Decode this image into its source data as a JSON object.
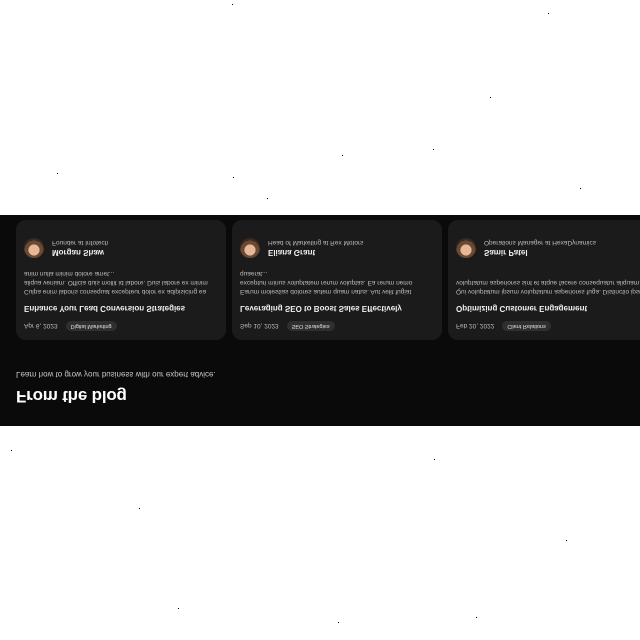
{
  "blog": {
    "title": "From the blog",
    "subtitle": "Learn how to grow your business with our expert advice."
  },
  "posts": [
    {
      "date": "Apr 6, 2023",
      "tag": "Digital Marketing",
      "title": "Enhance Your Lead Conversion Strategies",
      "excerpt": "Culpa enim laboris consequat excepteur dolor ex adipisicing ea aliqua veniam. Officia duis mollit id labore. Duis labore ex minim anim nulla minim dolore amet...",
      "author_name": "Morgan Shaw",
      "author_role": "Founder at Infotech"
    },
    {
      "date": "Sep 10, 2023",
      "tag": "SEO Strategies",
      "title": "Leveraging SEO to Boost Sales Effectively",
      "excerpt": "Earum molestias dolores autem quam natus. Aut velit fugiat excepturi minus voluptatem rerum voluptas. Ea rerum nemo quaerat...",
      "author_name": "Eliana Grant",
      "author_role": "Head of Marketing at Rex Motors"
    },
    {
      "date": "Feb 20, 2022",
      "tag": "Client Relations",
      "title": "Optimizing Customer Engagement",
      "excerpt": "Qui voluptatum ipsum voluptatum asperiores fuga. Distinctio ipsum voluptatum asperiores sint et atque facere consequatur aliquam.",
      "author_name": "Samir Patel",
      "author_role": "Operations Manager at HexaDynamics"
    }
  ]
}
